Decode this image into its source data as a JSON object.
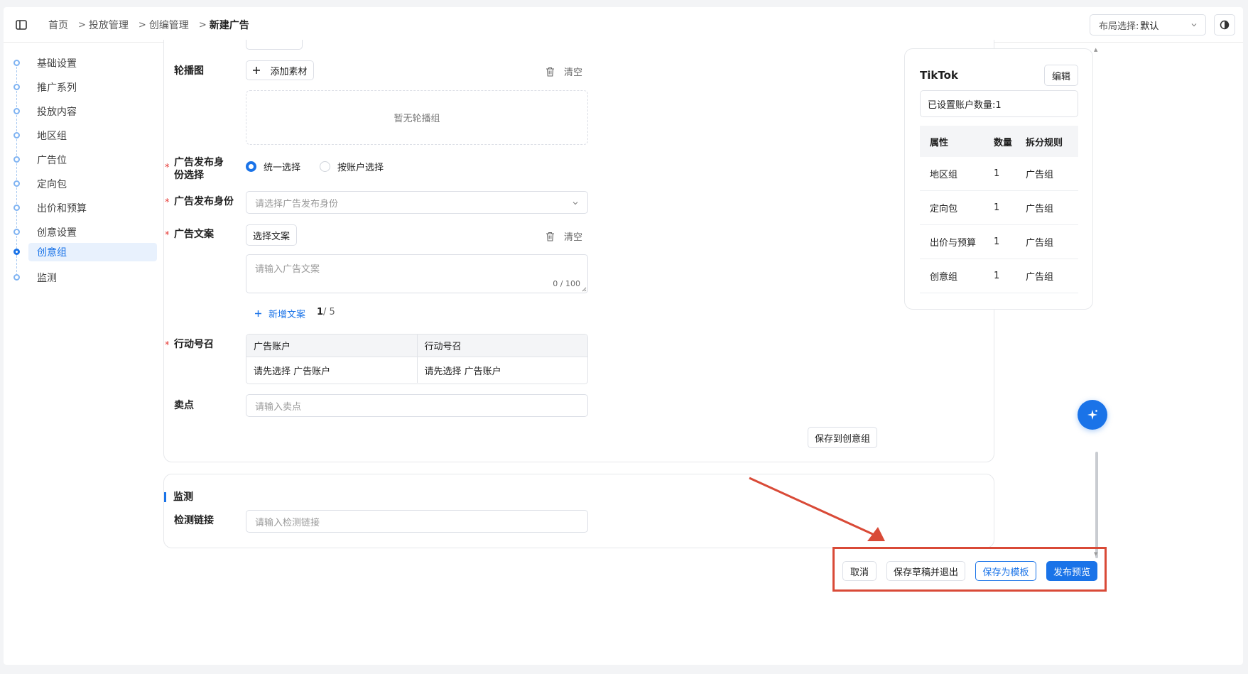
{
  "breadcrumb": {
    "items": [
      "首页",
      "投放管理",
      "创编管理"
    ],
    "current": "新建广告",
    "separator": ">"
  },
  "layout_select": {
    "label": "布局选择:",
    "value": "默认"
  },
  "steps": [
    {
      "label": "基础设置"
    },
    {
      "label": "推广系列"
    },
    {
      "label": "投放内容"
    },
    {
      "label": "地区组"
    },
    {
      "label": "广告位"
    },
    {
      "label": "定向包"
    },
    {
      "label": "出价和预算"
    },
    {
      "label": "创意设置"
    },
    {
      "label": "创意组",
      "active": true
    },
    {
      "label": "监测"
    }
  ],
  "form": {
    "carousel": {
      "label": "轮播图",
      "add_button": "添加素材",
      "clear_label": "清空",
      "empty_text": "暂无轮播组"
    },
    "identity_mode": {
      "label": "广告发布身份选择",
      "required": "*",
      "options": [
        "统一选择",
        "按账户选择"
      ],
      "selected": "统一选择"
    },
    "identity": {
      "label": "广告发布身份",
      "required": "*",
      "placeholder": "请选择广告发布身份"
    },
    "copy": {
      "label": "广告文案",
      "required": "*",
      "select_button": "选择文案",
      "clear_label": "清空",
      "placeholder": "请输入广告文案",
      "count": "0 / 100",
      "add_label": "新增文案",
      "page": "1",
      "page_total": "/ 5"
    },
    "cta": {
      "label": "行动号召",
      "required": "*",
      "columns": [
        "广告账户",
        "行动号召"
      ],
      "row": [
        "请先选择 广告账户",
        "请先选择 广告账户"
      ]
    },
    "selling_point": {
      "label": "卖点",
      "placeholder": "请输入卖点"
    },
    "save_group_button": "保存到创意组"
  },
  "monitor": {
    "title": "监测",
    "link_label": "检测链接",
    "link_placeholder": "请输入检测链接"
  },
  "right_panel": {
    "title": "TikTok",
    "edit_button": "编辑",
    "account_count": "已设置账户数量:1",
    "columns": [
      "属性",
      "数量",
      "拆分规则"
    ],
    "rows": [
      [
        "地区组",
        "1",
        "广告组"
      ],
      [
        "定向包",
        "1",
        "广告组"
      ],
      [
        "出价与预算",
        "1",
        "广告组"
      ],
      [
        "创意组",
        "1",
        "广告组"
      ]
    ]
  },
  "footer": {
    "cancel": "取消",
    "save_draft": "保存草稿并退出",
    "save_template": "保存为模板",
    "publish_preview": "发布预览"
  },
  "colors": {
    "primary": "#1a73e8",
    "required": "#e53935",
    "annotation": "#d94a37"
  }
}
